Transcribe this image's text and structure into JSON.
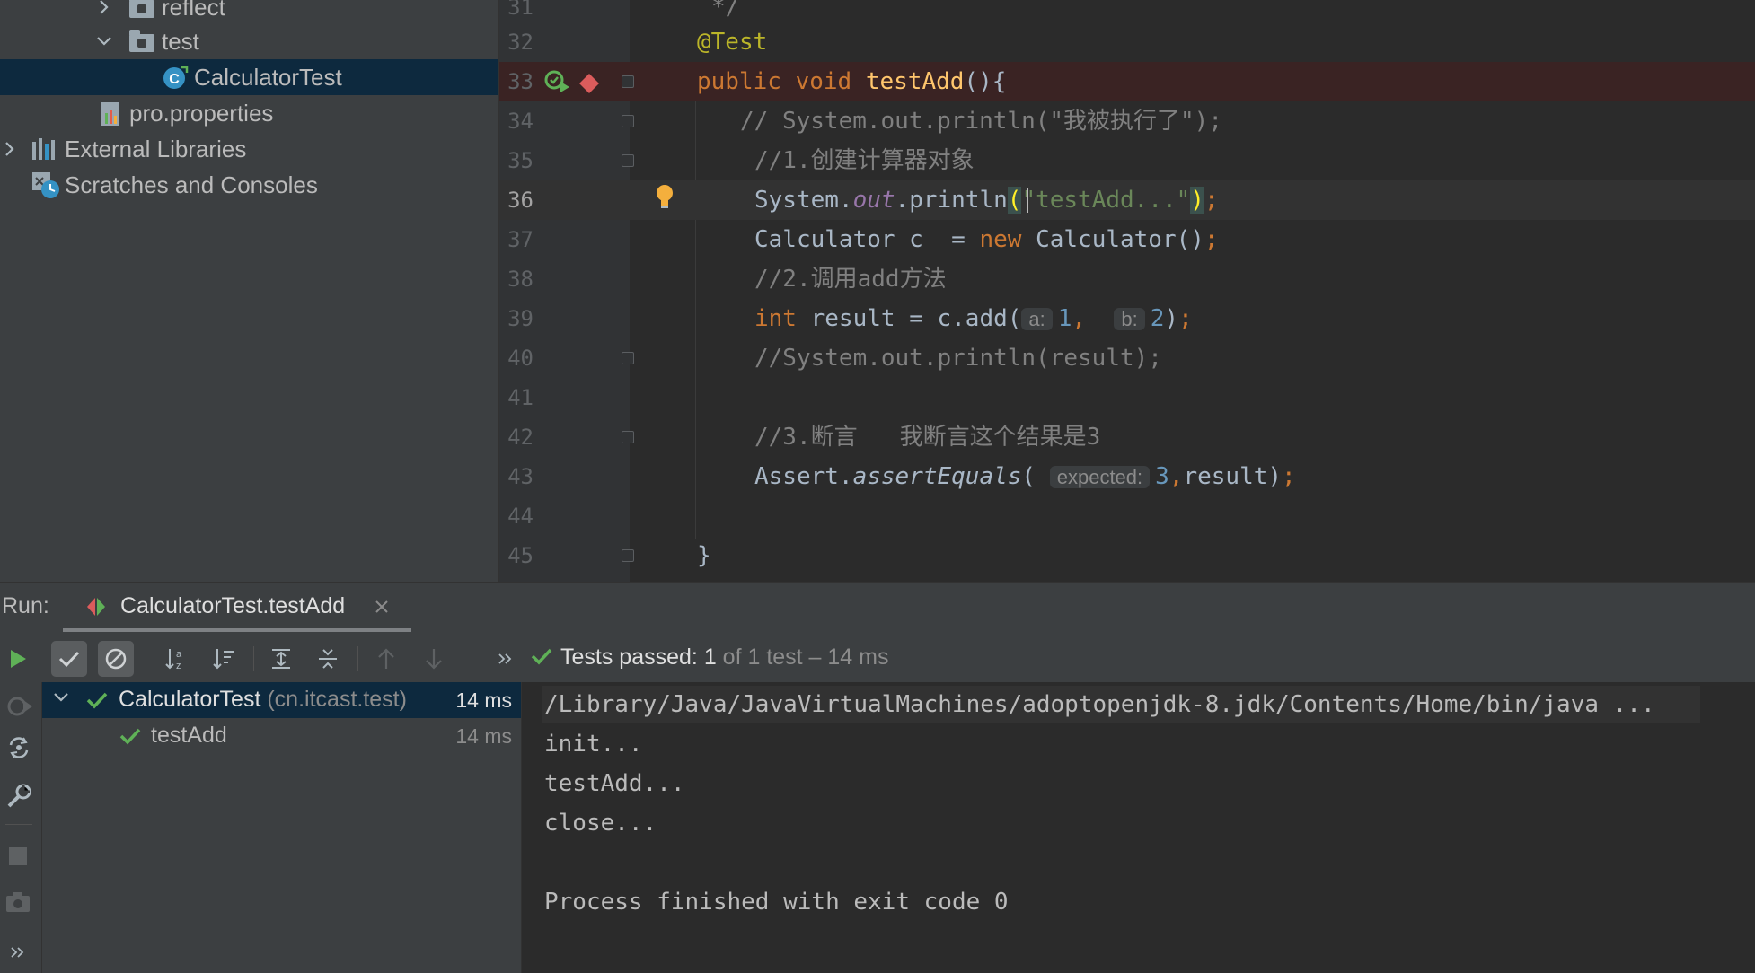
{
  "project_tree": {
    "items": [
      {
        "label": "reflect",
        "icon": "folder-icon",
        "expanded": false
      },
      {
        "label": "test",
        "icon": "folder-icon",
        "expanded": true
      },
      {
        "label": "CalculatorTest",
        "icon": "java-class-icon",
        "selected": true
      },
      {
        "label": "pro.properties",
        "icon": "properties-file-icon"
      },
      {
        "label": "External Libraries",
        "icon": "libraries-icon",
        "expanded": false
      },
      {
        "label": "Scratches and Consoles",
        "icon": "scratches-icon"
      }
    ]
  },
  "editor": {
    "line_numbers": [
      "31",
      "32",
      "33",
      "34",
      "35",
      "36",
      "37",
      "38",
      "39",
      "40",
      "41",
      "42",
      "43",
      "44",
      "45"
    ],
    "lines": {
      "l31": "*/",
      "l32": "@Test",
      "l33": {
        "kw": "public void ",
        "fn": "testAdd",
        "rest": "(){"
      },
      "l34": "// System.out.println(\"我被执行了\");",
      "l35": "//1.创建计算器对象",
      "l36": {
        "a": "System.",
        "field": "out",
        "b": ".println",
        "open": "(",
        "str": "\"testAdd...\"",
        "close": ")",
        "semi": ";"
      },
      "l37": {
        "a": "Calculator c  = ",
        "kw": "new",
        "b": " Calculator()",
        "semi": ";"
      },
      "l38": "//2.调用add方法",
      "l39": {
        "kw": "int",
        "a": " result = c.add(",
        "hint_a": "a:",
        "num1": "1",
        "comma": ",",
        "hint_b": "b:",
        "num2": "2",
        "close": ")",
        "semi": ";"
      },
      "l40": "//System.out.println(result);",
      "l42": "//3.断言   我断言这个结果是3",
      "l43": {
        "a": "Assert.",
        "method": "assertEquals",
        "open": "(",
        "hint": "expected:",
        "num": "3",
        "comma": ",",
        "b": "result)",
        "semi": ";"
      },
      "l45": "}"
    }
  },
  "run": {
    "label": "Run:",
    "tab_title": "CalculatorTest.testAdd",
    "status_prefix": "Tests passed:",
    "status_count": "1",
    "status_rest": "of 1 test – 14 ms",
    "tests": [
      {
        "name": "CalculatorTest",
        "package": "(cn.itcast.test)",
        "time": "14 ms"
      },
      {
        "name": "testAdd",
        "time": "14 ms"
      }
    ],
    "console": {
      "command": "/Library/Java/JavaVirtualMachines/adoptopenjdk-8.jdk/Contents/Home/bin/java ...",
      "output": [
        "init...",
        "testAdd...",
        "close...",
        "",
        "Process finished with exit code 0"
      ]
    }
  },
  "colors": {
    "keyword": "#cc7832",
    "function": "#ffc66d",
    "annotation": "#bbb529",
    "comment": "#808080",
    "string": "#6a8759",
    "number": "#6897bb",
    "pass_green": "#5fb157"
  }
}
